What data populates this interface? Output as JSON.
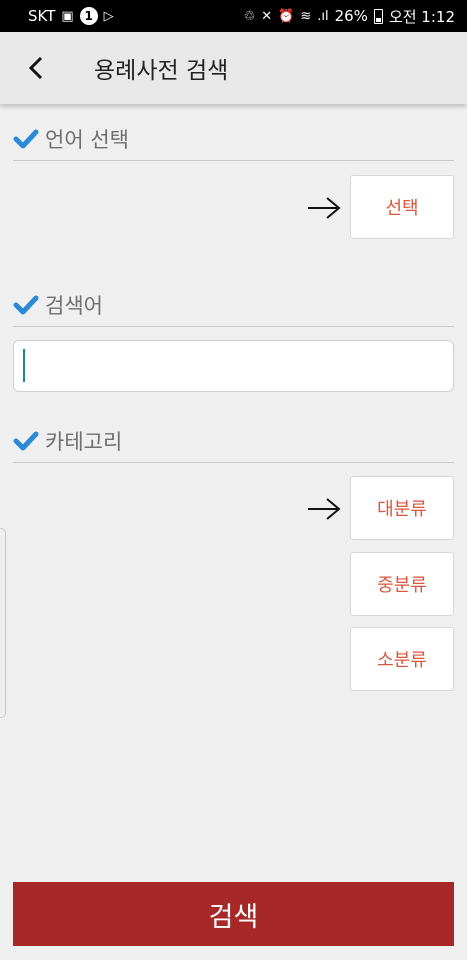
{
  "status_bar": {
    "carrier": "SKT",
    "notification_count": "1",
    "signal_text": "26%",
    "time": "오전 1:12"
  },
  "header": {
    "title": "용례사전 검색"
  },
  "sections": {
    "language": {
      "label": "언어 선택",
      "button": "선택"
    },
    "keyword": {
      "label": "검색어",
      "value": ""
    },
    "category": {
      "label": "카테고리",
      "buttons": [
        "대분류",
        "중분류",
        "소분류"
      ]
    }
  },
  "footer": {
    "search_label": "검색"
  },
  "colors": {
    "accent_button": "#a62828",
    "option_text": "#d9573d",
    "check": "#2a8ad8"
  }
}
